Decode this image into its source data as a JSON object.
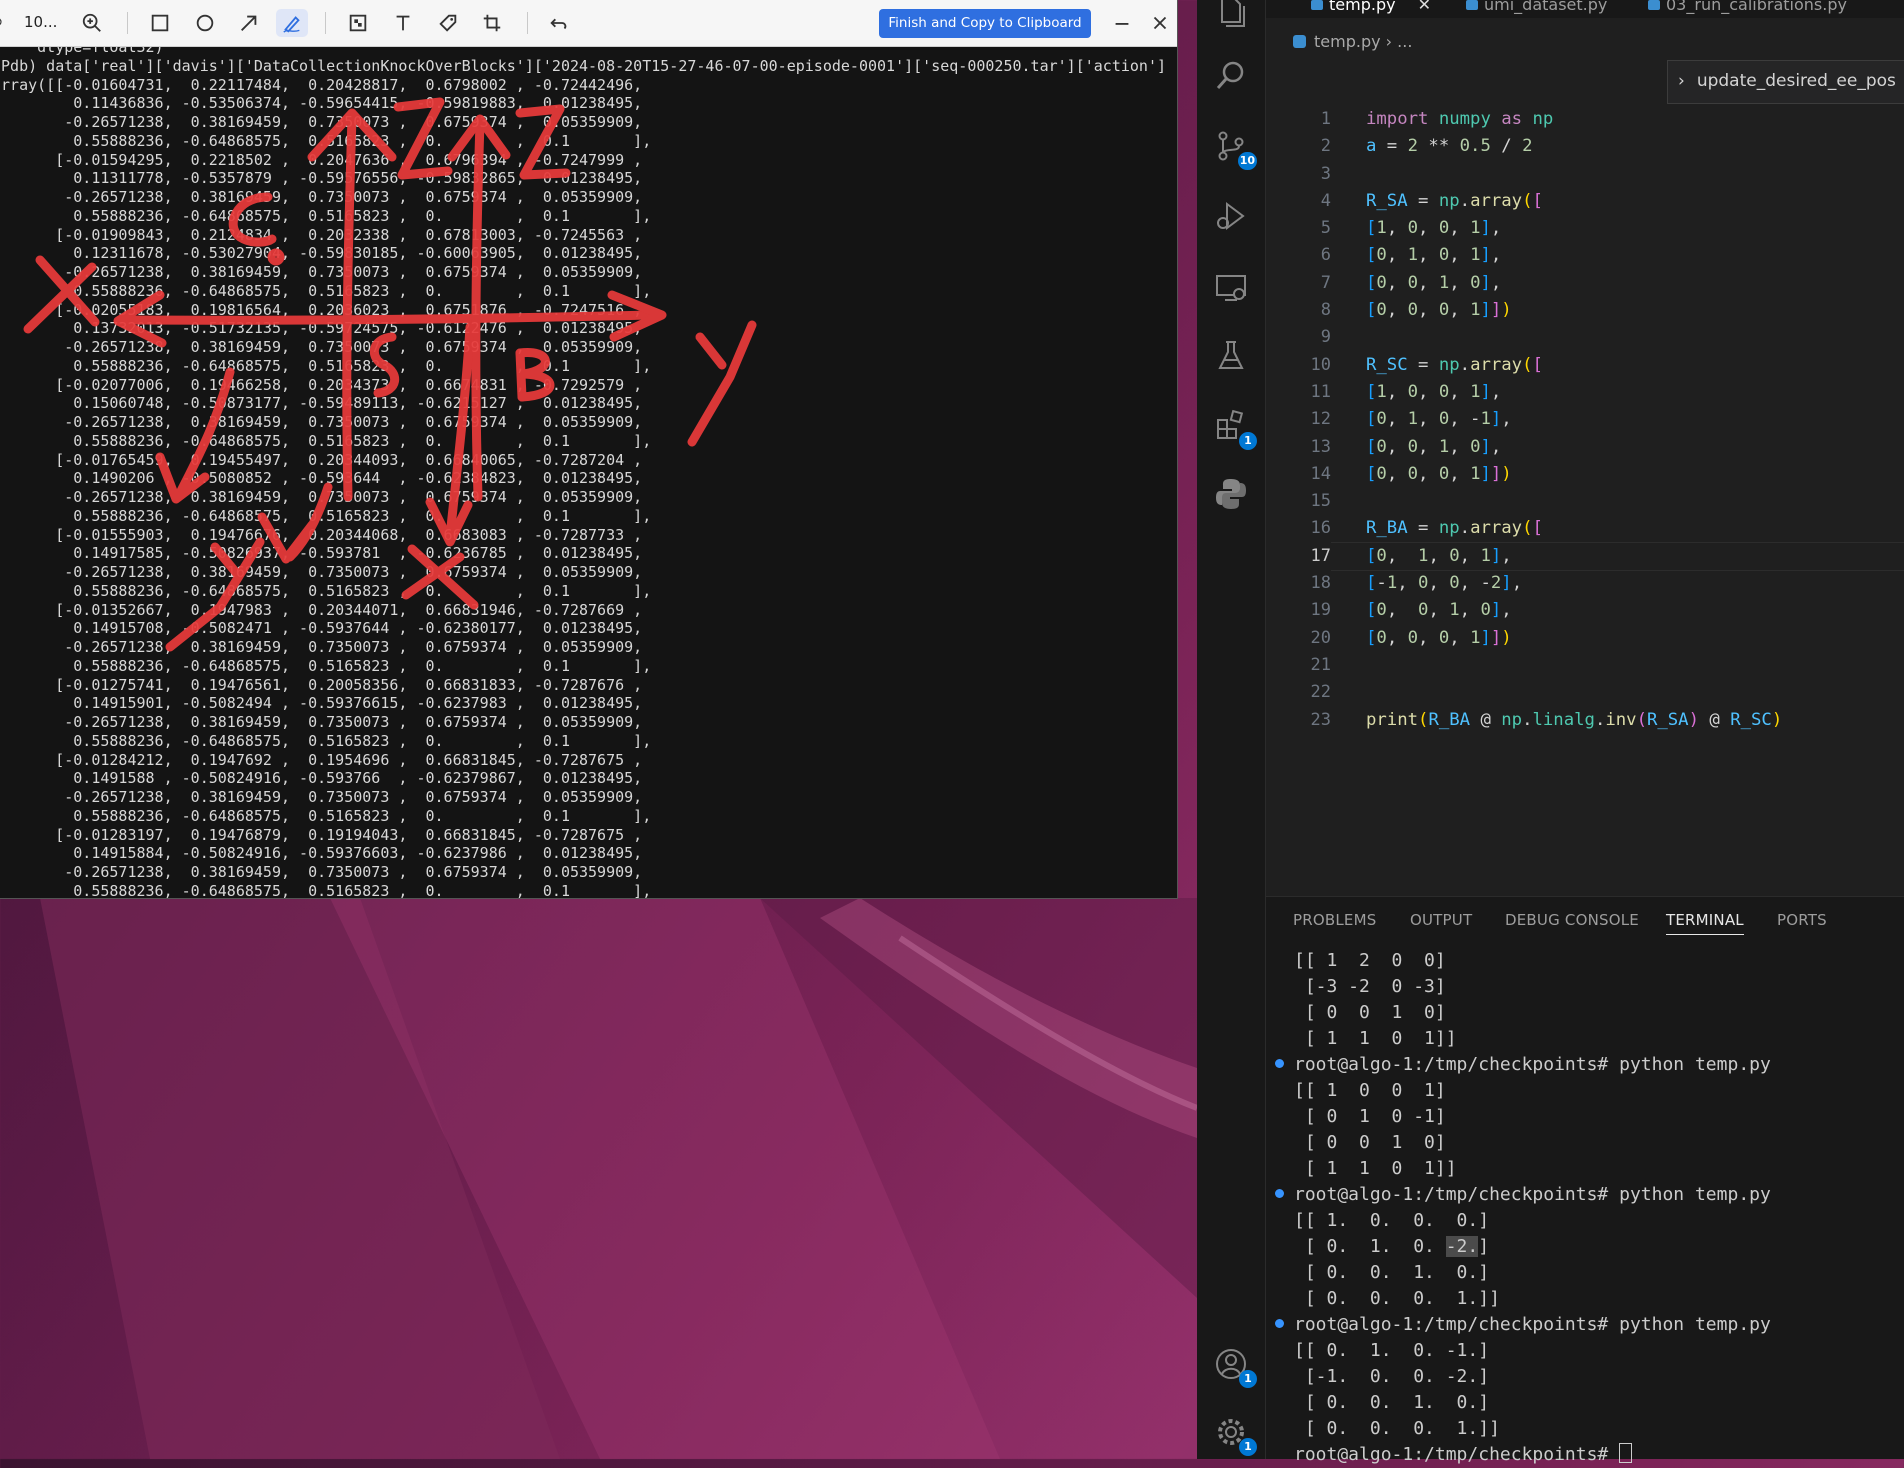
{
  "annotation_tool": {
    "zoom": "10...",
    "finish_button": "Finish and Copy to Clipboard",
    "terminal_lines": [
      "     dtype=float32)",
      "(Pdb) data['real']['davis']['DataCollectionKnockOverBlocks']['2024-08-20T15-27-46-07-00-episode-0001']['seq-000250.tar']['action']",
      "array([[-0.01604731,  0.22117484,  0.20428817,  0.6798002 , -0.72442496,",
      "         0.11436836, -0.53506374, -0.59654415, -0.59819883,  0.01238495,",
      "        -0.26571238,  0.38169459,  0.7350073 ,  0.6759374 ,  0.05359909,",
      "         0.55888236, -0.64868575,  0.5165823 ,  0.        ,  0.1       ],",
      "       [-0.01594295,  0.2218502 ,  0.2047636 ,  0.6796394 , -0.7247999 ,",
      "         0.11311778, -0.5357879 , -0.59576556, -0.59832865,  0.01238495,",
      "        -0.26571238,  0.38169459,  0.7350073 ,  0.6759374 ,  0.05359909,",
      "         0.55888236, -0.64868575,  0.5165823 ,  0.        ,  0.1       ],",
      "       [-0.01909843,  0.2124834 ,  0.2032338 ,  0.67813003, -0.7245563 ,",
      "         0.12311678, -0.53027904, -0.59830185, -0.60063905,  0.01238495,",
      "        -0.26571238,  0.38169459,  0.7350073 ,  0.6759374 ,  0.05359909,",
      "         0.55888236, -0.64868575,  0.5165823 ,  0.        ,  0.1       ],",
      "       [-0.02055183,  0.19816564,  0.2036023 ,  0.6751876 , -0.7247516 ,",
      "         0.13732013, -0.51732135, -0.59724575, -0.6122476 ,  0.01238495,",
      "        -0.26571238,  0.38169459,  0.7350073 ,  0.6759374 ,  0.05359909,",
      "         0.55888236, -0.64868575,  0.5165823 ,  0.        ,  0.1       ],",
      "       [-0.02077006,  0.19466258,  0.2034373 ,  0.6674831 , -0.7292579 ,",
      "         0.15060748, -0.50873177, -0.59489113, -0.6215127 ,  0.01238495,",
      "        -0.26571238,  0.38169459,  0.7350073 ,  0.6759374 ,  0.05359909,",
      "         0.55888236, -0.64868575,  0.5165823 ,  0.        ,  0.1       ],",
      "       [-0.01765459,  0.19455497,  0.20344093,  0.66840065, -0.7287204 ,",
      "         0.1490206 , -0.5080852 , -0.593644  , -0.62384823,  0.01238495,",
      "        -0.26571238,  0.38169459,  0.7350073 ,  0.6759374 ,  0.05359909,",
      "         0.55888236, -0.64868575,  0.5165823 ,  0.        ,  0.1       ],",
      "       [-0.01555903,  0.19476676,  0.20344068,  0.6683083 , -0.7287733 ,",
      "         0.14917585, -0.50826937, -0.593781  , -0.6236785 ,  0.01238495,",
      "        -0.26571238,  0.38169459,  0.7350073 ,  0.6759374 ,  0.05359909,",
      "         0.55888236, -0.64868575,  0.5165823 ,  0.        ,  0.1       ],",
      "       [-0.01352667,  0.1947983 ,  0.20344071,  0.66831946, -0.7287669 ,",
      "         0.14915708, -0.5082471 , -0.5937644 , -0.62380177,  0.01238495,",
      "        -0.26571238,  0.38169459,  0.7350073 ,  0.6759374 ,  0.05359909,",
      "         0.55888236, -0.64868575,  0.5165823 ,  0.        ,  0.1       ],",
      "       [-0.01275741,  0.19476561,  0.20058356,  0.66831833, -0.7287676 ,",
      "         0.14915901, -0.5082494 , -0.59376615, -0.6237983 ,  0.01238495,",
      "        -0.26571238,  0.38169459,  0.7350073 ,  0.6759374 ,  0.05359909,",
      "         0.55888236, -0.64868575,  0.5165823 ,  0.        ,  0.1       ],",
      "       [-0.01284212,  0.1947692 ,  0.1954696 ,  0.66831845, -0.7287675 ,",
      "         0.1491588 , -0.50824916, -0.593766  , -0.62379867,  0.01238495,",
      "        -0.26571238,  0.38169459,  0.7350073 ,  0.6759374 ,  0.05359909,",
      "         0.55888236, -0.64868575,  0.5165823 ,  0.        ,  0.1       ],",
      "       [-0.01283197,  0.19476879,  0.19194043,  0.66831845, -0.7287675 ,",
      "         0.14915884, -0.50824916, -0.59376603, -0.6237986 ,  0.01238495,",
      "        -0.26571238,  0.38169459,  0.7350073 ,  0.6759374 ,  0.05359909,",
      "         0.55888236, -0.64868575,  0.5165823 ,  0.        ,  0.1       ],"
    ],
    "drawn_labels": {
      "x_left": "X",
      "y_right": "Y",
      "z_top": "Z",
      "c": "C",
      "s": "S",
      "b": "B",
      "y_bottom": "Y",
      "x_bottom": "X"
    },
    "stroke_color": "#e83a3a"
  },
  "vscode": {
    "tabs": [
      "temp.py",
      "umi_dataset.py",
      "03_run_calibrations.py"
    ],
    "breadcrumb": "temp.py",
    "breadcrumb_more": "...",
    "outline_widget": "update_desired_ee_pos",
    "activity_badges": {
      "source_control": "10",
      "extensions": "1",
      "accounts": "1",
      "manage": "1"
    },
    "line_numbers": [
      "1",
      "2",
      "3",
      "4",
      "5",
      "6",
      "7",
      "8",
      "9",
      "10",
      "11",
      "12",
      "13",
      "14",
      "15",
      "16",
      "17",
      "18",
      "19",
      "20",
      "21",
      "22",
      "23"
    ],
    "current_line": 17,
    "panel_tabs": [
      "PROBLEMS",
      "OUTPUT",
      "DEBUG CONSOLE",
      "TERMINAL",
      "PORTS"
    ],
    "active_panel_tab": "TERMINAL",
    "terminal": {
      "prompt": "root@algo-1:/tmp/checkpoints# python temp.py",
      "last_prompt": "root@algo-1:/tmp/checkpoints# ",
      "out1": [
        "[[ 1  2  0  0]",
        " [-3 -2  0 -3]",
        " [ 0  0  1  0]",
        " [ 1  1  0  1]]"
      ],
      "out2": [
        "[[ 1  0  0  1]",
        " [ 0  1  0 -1]",
        " [ 0  0  1  0]",
        " [ 1  1  0  1]]"
      ],
      "out3_a": "[[ 1.  0.  0.  0.]",
      "out3_b_pre": " [ 0.  1.  0. ",
      "out3_b_sel": "-2.",
      "out3_b_post": "]",
      "out3_c": " [ 0.  0.  1.  0.]",
      "out3_d": " [ 0.  0.  0.  1.]]",
      "out4": [
        "[[ 0.  1.  0. -1.]",
        " [-1.  0.  0. -2.]",
        " [ 0.  0.  1.  0.]",
        " [ 0.  0.  0.  1.]]"
      ]
    }
  }
}
